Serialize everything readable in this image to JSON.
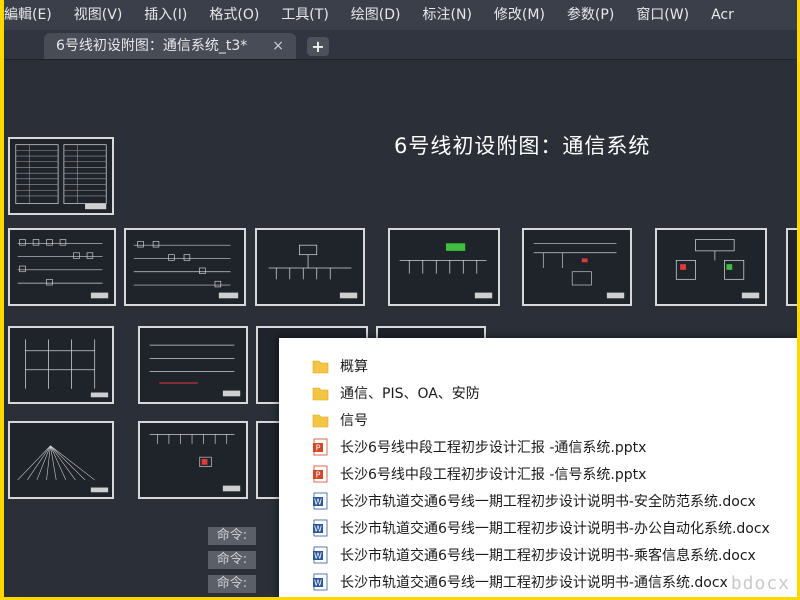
{
  "menu": {
    "items": [
      "編輯(E)",
      "视图(V)",
      "插入(I)",
      "格式(O)",
      "工具(T)",
      "绘图(D)",
      "标注(N)",
      "修改(M)",
      "参数(P)",
      "窗口(W)",
      "Acr"
    ]
  },
  "tabs": {
    "active_label": "6号线初设附图：通信系统_t3*",
    "close_glyph": "×",
    "add_glyph": "+"
  },
  "drawing": {
    "title": "6号线初设附图：通信系统"
  },
  "command_line": {
    "prompts": [
      "命令:",
      "命令:",
      "命令:"
    ]
  },
  "explorer": {
    "items": [
      {
        "type": "folder",
        "icon": "folder-icon",
        "name": "概算"
      },
      {
        "type": "folder",
        "icon": "folder-icon",
        "name": "通信、PIS、OA、安防"
      },
      {
        "type": "folder",
        "icon": "folder-icon",
        "name": "信号"
      },
      {
        "type": "pptx",
        "icon": "powerpoint-icon",
        "name": "长沙6号线中段工程初步设计汇报 -通信系统.pptx"
      },
      {
        "type": "pptx",
        "icon": "powerpoint-icon",
        "name": "长沙6号线中段工程初步设计汇报 -信号系统.pptx"
      },
      {
        "type": "docx",
        "icon": "word-icon",
        "name": "长沙市轨道交通6号线一期工程初步设计说明书-安全防范系统.docx"
      },
      {
        "type": "docx",
        "icon": "word-icon",
        "name": "长沙市轨道交通6号线一期工程初步设计说明书-办公自动化系统.docx"
      },
      {
        "type": "docx",
        "icon": "word-icon",
        "name": "长沙市轨道交通6号线一期工程初步设计说明书-乘客信息系统.docx"
      },
      {
        "type": "docx",
        "icon": "word-icon",
        "name": "长沙市轨道交通6号线一期工程初步设计说明书-通信系统.docx"
      }
    ]
  },
  "watermark": "bdocx",
  "colors": {
    "border": "#ffd800",
    "canvas": "#2a2f38",
    "menubar": "#3a3f4a",
    "folder": "#f4c542",
    "powerpoint": "#d24726",
    "word": "#2b579a"
  }
}
